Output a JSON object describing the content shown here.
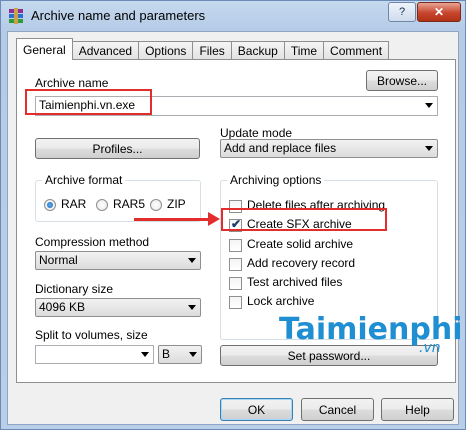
{
  "window": {
    "title": "Archive name and parameters",
    "help_glyph": "?",
    "close_glyph": "✕"
  },
  "tabs": [
    {
      "label": "General",
      "active": true
    },
    {
      "label": "Advanced"
    },
    {
      "label": "Options"
    },
    {
      "label": "Files"
    },
    {
      "label": "Backup"
    },
    {
      "label": "Time"
    },
    {
      "label": "Comment"
    }
  ],
  "general": {
    "archive_name_label": "Archive name",
    "browse_label": "Browse...",
    "archive_name_value": "Taimienphi.vn.exe",
    "profiles_label": "Profiles...",
    "update_mode_label": "Update mode",
    "update_mode_value": "Add and replace files",
    "archive_format": {
      "title": "Archive format",
      "options": [
        "RAR",
        "RAR5",
        "ZIP"
      ],
      "selected": "RAR"
    },
    "compression_method_label": "Compression method",
    "compression_method_value": "Normal",
    "dictionary_size_label": "Dictionary size",
    "dictionary_size_value": "4096 KB",
    "split_label": "Split to volumes, size",
    "split_value": "",
    "split_unit": "B",
    "archiving_options": {
      "title": "Archiving options",
      "items": [
        {
          "label": "Delete files after archiving",
          "checked": false
        },
        {
          "label": "Create SFX archive",
          "checked": true
        },
        {
          "label": "Create solid archive",
          "checked": false
        },
        {
          "label": "Add recovery record",
          "checked": false
        },
        {
          "label": "Test archived files",
          "checked": false
        },
        {
          "label": "Lock archive",
          "checked": false
        }
      ]
    },
    "set_password_label": "Set password..."
  },
  "footer": {
    "ok_label": "OK",
    "cancel_label": "Cancel",
    "help_label": "Help"
  },
  "watermark": {
    "brand": "Taimienphi",
    "suffix": ".vn"
  },
  "colors": {
    "annotation_red": "#e32d2d",
    "watermark_blue": "#1f8fd2"
  }
}
